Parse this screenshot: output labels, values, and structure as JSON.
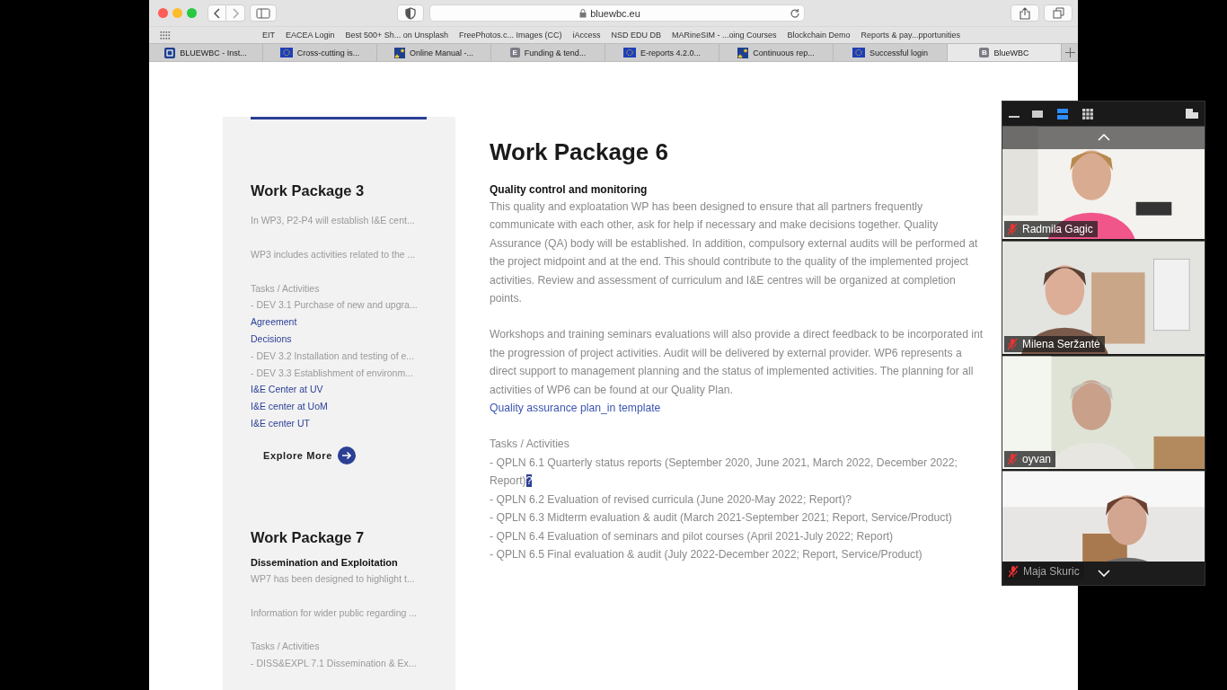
{
  "browser": {
    "url": "bluewbc.eu",
    "bookmarks": [
      "EIT",
      "EACEA Login",
      "Best 500+ Sh... on Unsplash",
      "FreePhotos.c... Images (CC)",
      "iAccess",
      "NSD EDU DB",
      "MARineSIM - ...oing Courses",
      "Blockchain Demo",
      "Reports & pay...pportunities"
    ],
    "tabs": [
      {
        "label": "BLUEWBC - Inst...",
        "kind": "square",
        "selected": false
      },
      {
        "label": "Cross-cutting is...",
        "kind": "flag",
        "selected": false
      },
      {
        "label": "Online Manual -...",
        "kind": "star",
        "selected": false
      },
      {
        "label": "Funding & tend...",
        "kind": "letter",
        "icon_text": "E",
        "selected": false
      },
      {
        "label": "E-reports 4.2.0...",
        "kind": "flag",
        "selected": false
      },
      {
        "label": "Continuous rep...",
        "kind": "star",
        "selected": false
      },
      {
        "label": "Successful login",
        "kind": "flag",
        "selected": false
      },
      {
        "label": "BlueWBC",
        "kind": "letter",
        "icon_text": "B",
        "selected": true
      }
    ]
  },
  "sidebar": {
    "sections": [
      {
        "title": "Work Package 3",
        "items": [
          {
            "kind": "text",
            "text": "In WP3, P2-P4 will establish I&E cent..."
          },
          {
            "kind": "gap"
          },
          {
            "kind": "text",
            "text": "WP3 includes activities related to the ..."
          },
          {
            "kind": "gap"
          },
          {
            "kind": "text",
            "text": "Tasks / Activities"
          },
          {
            "kind": "text",
            "text": "- DEV 3.1 Purchase of new and upgra..."
          },
          {
            "kind": "link",
            "text": "Agreement"
          },
          {
            "kind": "link",
            "text": "Decisions"
          },
          {
            "kind": "text",
            "text": "- DEV 3.2 Installation and testing of e..."
          },
          {
            "kind": "text",
            "text": "- DEV 3.3 Establishment of environm..."
          },
          {
            "kind": "link",
            "text": "I&E Center at UV"
          },
          {
            "kind": "link",
            "text": "I&E center at UoM"
          },
          {
            "kind": "link",
            "text": "I&E center UT"
          }
        ],
        "button": "Explore More"
      },
      {
        "title": "Work Package 7",
        "subtitle": "Dissemination and Exploitation",
        "items": [
          {
            "kind": "text",
            "text": "WP7 has been designed to highlight t..."
          },
          {
            "kind": "gap"
          },
          {
            "kind": "text",
            "text": "Information for wider public regarding ..."
          },
          {
            "kind": "gap"
          },
          {
            "kind": "text",
            "text": "Tasks / Activities"
          },
          {
            "kind": "text",
            "text": "- DISS&EXPL 7.1 Dissemination & Ex..."
          }
        ]
      }
    ]
  },
  "main": {
    "title": "Work Package 6",
    "subtitle": "Quality control and monitoring",
    "paragraphs": [
      [
        "This quality and exploatation WP has been designed to ensure that all partners frequently",
        "communicate with each other, ask for help if necessary and make decisions together. Quality",
        "Assurance (QA) body will be established. In addition, compulsory external audits will be performed at",
        "the project midpoint and at the end. This should contribute to the quality of the implemented project",
        "activities. Review and assessment of curriculum and I&E centres will be organized at completion",
        "points."
      ],
      [
        "Workshops and training seminars evaluations will also provide a direct feedback to be incorporated int",
        "the progression of project activities. Audit will be delivered by external provider. WP6 represents a",
        "direct support to management planning and the status of implemented activities. The planning for all",
        "activities of WP6 can be found at our Quality Plan."
      ]
    ],
    "link": "Quality assurance plan_in template",
    "tasks_heading": "Tasks / Activities",
    "tasks": [
      {
        "text": "- QPLN 6.1 Quarterly status reports (September 2020, June 2021, March 2022, December 2022; Report)",
        "selection": "?"
      },
      {
        "text": "- QPLN 6.2 Evaluation of revised curricula (June 2020-May 2022; Report)?"
      },
      {
        "text": "- QPLN 6.3 Midterm evaluation & audit (March 2021-September 2021; Report, Service/Product)"
      },
      {
        "text": "- QPLN 6.4 Evaluation of seminars and pilot courses (April 2021-July 2022; Report)"
      },
      {
        "text": "- QPLN 6.5 Final evaluation & audit (July 2022-December 2022; Report, Service/Product)"
      }
    ]
  },
  "meeting": {
    "view_modes": [
      {
        "kind": "thumbnail",
        "selected": false
      },
      {
        "kind": "speaker",
        "selected": true
      },
      {
        "kind": "gallery",
        "selected": false
      }
    ],
    "participants": [
      {
        "name": "Radmila Gagic",
        "muted": true
      },
      {
        "name": "Milena Seržantė",
        "muted": true
      },
      {
        "name": "oyvan",
        "muted": true
      },
      {
        "name": "Maja Skuric",
        "muted": true,
        "dimmed": true
      }
    ]
  }
}
